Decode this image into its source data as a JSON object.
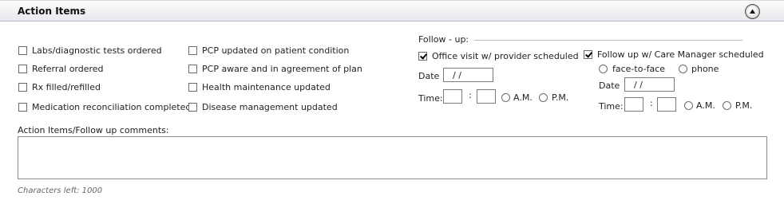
{
  "header": {
    "title": "Action Items"
  },
  "left_checks": [
    {
      "label": "Labs/diagnostic tests ordered",
      "checked": false
    },
    {
      "label": "Referral ordered",
      "checked": false
    },
    {
      "label": "Rx filled/refilled",
      "checked": false
    },
    {
      "label": "Medication reconciliation completed",
      "checked": false
    }
  ],
  "mid_checks": [
    {
      "label": "PCP updated on patient condition",
      "checked": false
    },
    {
      "label": "PCP aware and in agreement of plan",
      "checked": false
    },
    {
      "label": "Health maintenance updated",
      "checked": false
    },
    {
      "label": "Disease management updated",
      "checked": false
    }
  ],
  "followup": {
    "heading": "Follow - up:",
    "office": {
      "label": "Office visit w/ provider scheduled",
      "checked": true,
      "date_label": "Date",
      "date_value": "  / /",
      "time_label": "Time:",
      "time_sep": ":",
      "am": "A.M.",
      "pm": "P.M."
    },
    "care_manager": {
      "label": "Follow up w/ Care Manager scheduled",
      "checked": true,
      "mode_face": "face-to-face",
      "mode_phone": "phone",
      "date_label": "Date",
      "date_value": "  / /",
      "time_label": "Time:",
      "time_sep": ":",
      "am": "A.M.",
      "pm": "P.M."
    }
  },
  "comments": {
    "label": "Action Items/Follow up comments:",
    "value": "",
    "chars_left": "Characters left: 1000"
  }
}
